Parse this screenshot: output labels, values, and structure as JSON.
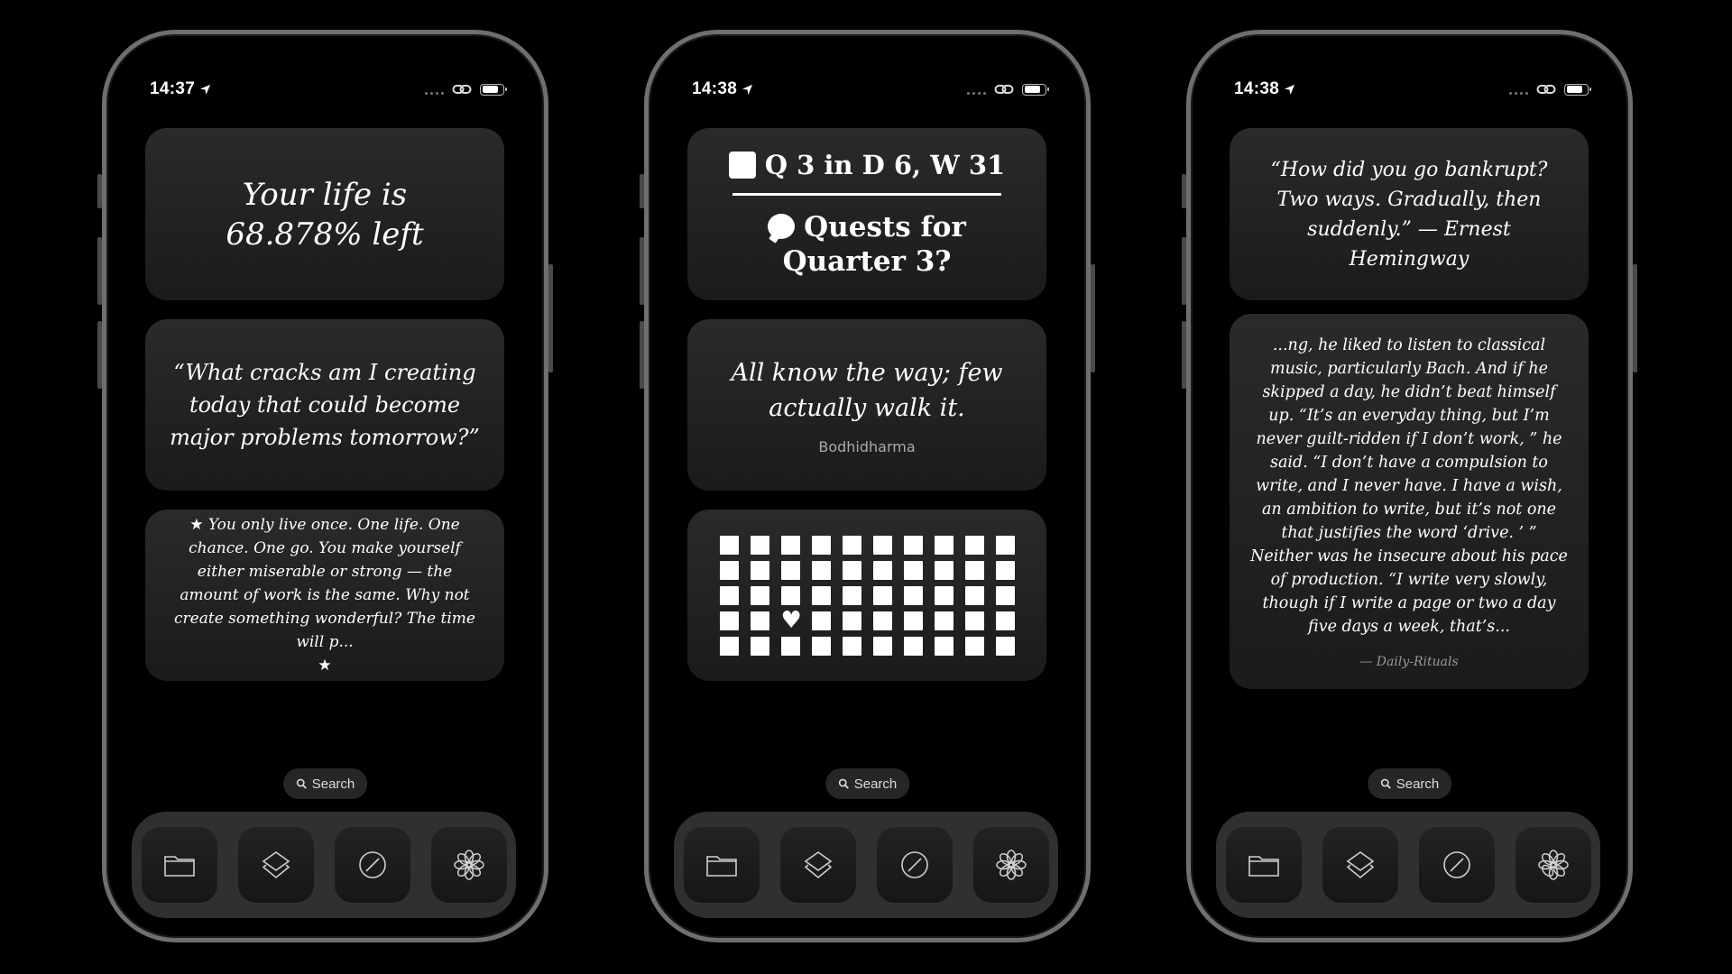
{
  "phones": [
    {
      "time": "14:37",
      "widgets": {
        "life_line1": "Your life is",
        "life_line2": "68.878% left",
        "quote": "“What cracks am I creating today that could become major problems tomorrow?”",
        "yolo_star_top": "★",
        "yolo": "You only live once. One life. One chance. One go. You make yourself either miserable or strong — the amount of work is the same. Why not create something wonderful? The time will p...",
        "yolo_star_bottom": "★"
      },
      "search_label": "Search"
    },
    {
      "time": "14:38",
      "widgets": {
        "quest_header": "Q 3 in D 6, W 31",
        "quest_prompt_line1": "Quests for",
        "quest_prompt_line2": "Quarter 3?",
        "bodhi_quote": "All know the way; few actually walk it.",
        "bodhi_author": "Bodhidharma",
        "heart": "♥"
      },
      "search_label": "Search"
    },
    {
      "time": "14:38",
      "widgets": {
        "hem_quote": "“How did you go bankrupt? Two ways. Gradually, then suddenly.” — Ernest Hemingway",
        "rituals_text": "...ng, he liked to listen to classical music, particularly Bach. And if he skipped a day, he didn’t beat himself up. “It’s an everyday thing, but I’m never guilt-ridden if I don’t work, ” he said. “I don’t have a compulsion to write, and I never have. I have a wish, an ambition to write, but it’s not one that justifies the word ‘drive. ’ ” Neither was he insecure about his pace of production. “I write very slowly, though if I write a page or two a day five days a week, that’s...",
        "rituals_source": "— Daily-Rituals"
      },
      "search_label": "Search"
    }
  ],
  "dock_icons": [
    "folder-icon",
    "layers-icon",
    "compass-icon",
    "flower-icon"
  ],
  "progress_grid": {
    "rows": 5,
    "cols": 10,
    "heart_position": {
      "row": 4,
      "col": 3
    }
  }
}
